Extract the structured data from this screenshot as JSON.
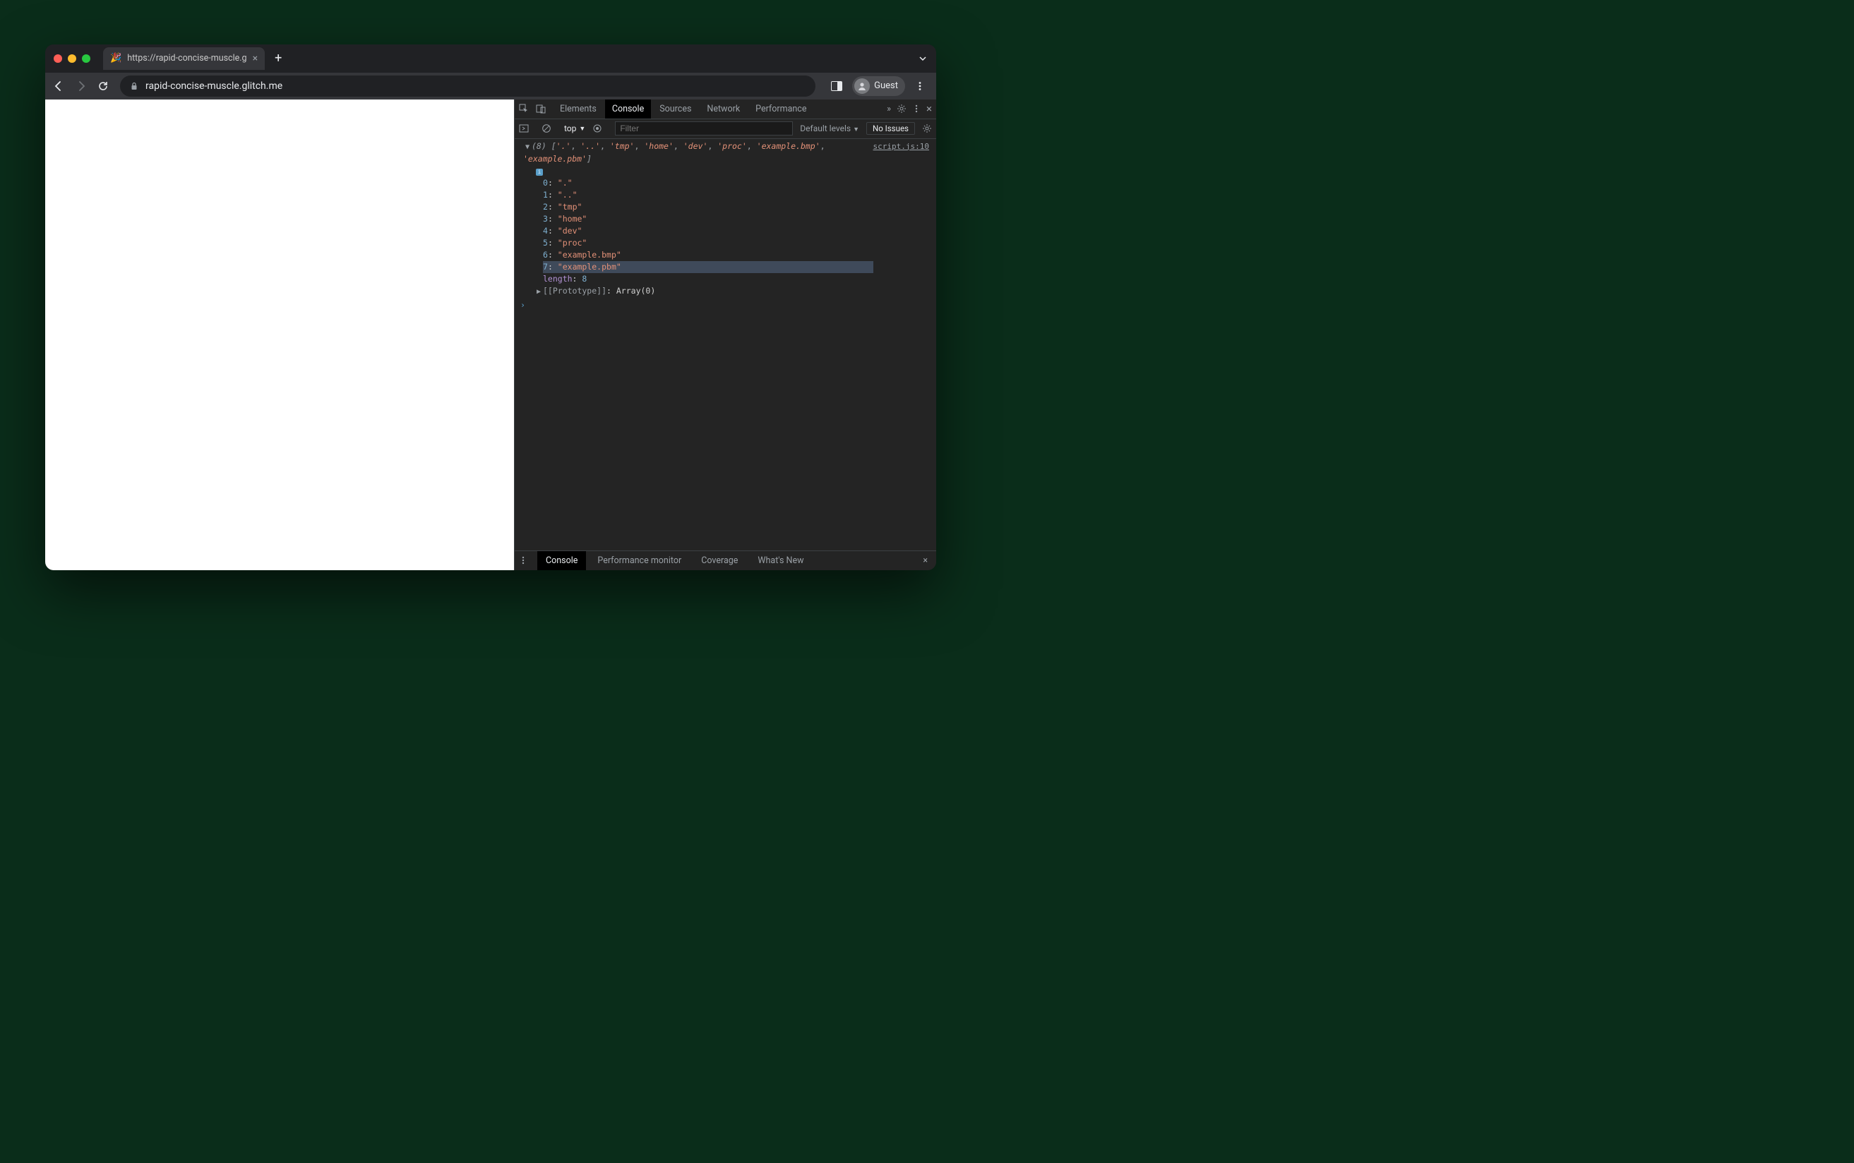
{
  "browser": {
    "tab": {
      "favicon": "🎉",
      "title": "https://rapid-concise-muscle.g",
      "close": "×"
    },
    "newtab": "+",
    "url": "rapid-concise-muscle.glitch.me",
    "profile": "Guest"
  },
  "devtools": {
    "tabs": [
      "Elements",
      "Console",
      "Sources",
      "Network",
      "Performance"
    ],
    "active_tab": "Console",
    "more": "»",
    "context": "top",
    "filter_placeholder": "Filter",
    "levels": "Default levels",
    "issues": "No Issues",
    "source_link": "script.js:10",
    "array": {
      "count": "(8)",
      "items": [
        ".",
        "..",
        "tmp",
        "home",
        "dev",
        "proc",
        "example.bmp",
        "example.pbm"
      ],
      "length_label": "length",
      "length_value": "8",
      "proto_label": "[[Prototype]]",
      "proto_value": "Array(0)"
    },
    "drawer": {
      "tabs": [
        "Console",
        "Performance monitor",
        "Coverage",
        "What's New"
      ],
      "active": "Console"
    }
  }
}
